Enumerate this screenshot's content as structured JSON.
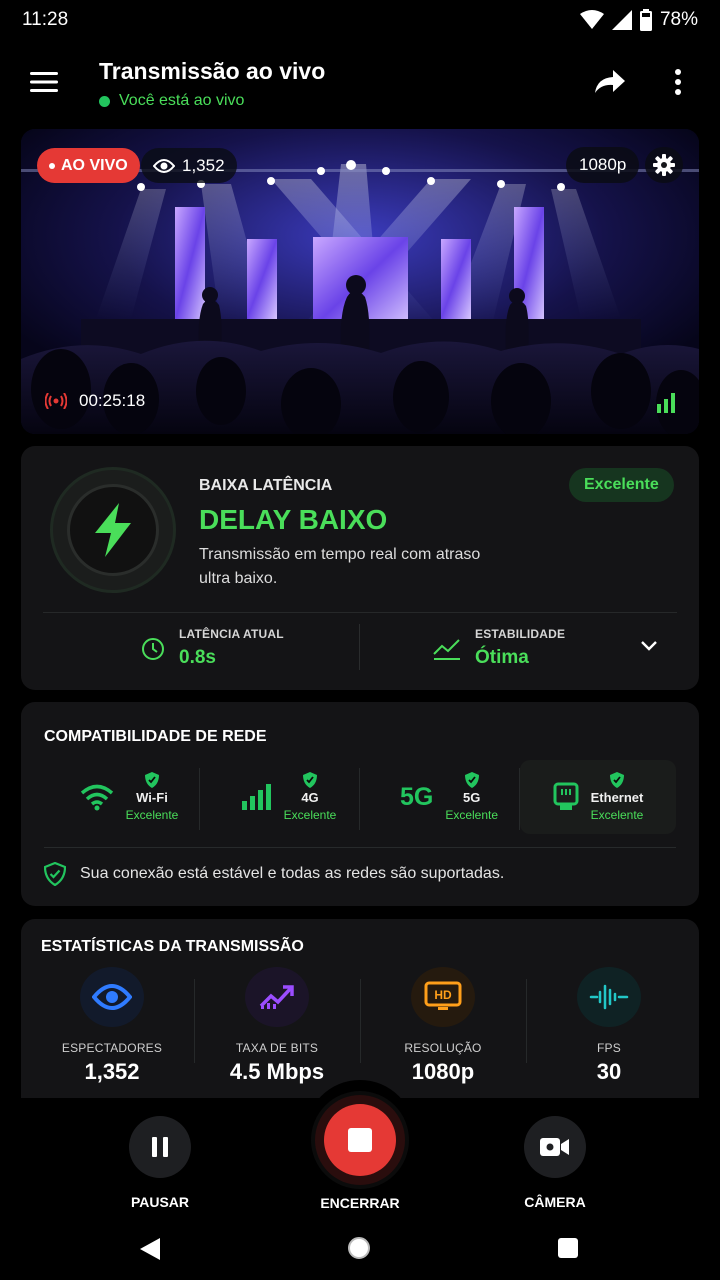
{
  "status_bar": {
    "time": "11:28",
    "battery": "78%"
  },
  "header": {
    "title": "Transmissão ao vivo",
    "subtitle": "Você está ao vivo"
  },
  "video": {
    "live_label": "AO VIVO",
    "viewers": "1,352",
    "resolution": "1080p",
    "elapsed": "00:25:18"
  },
  "latency": {
    "overline": "BAIXA LATÊNCIA",
    "title": "DELAY BAIXO",
    "description": "Transmissão em tempo real com atraso ultra baixo.",
    "badge": "Excelente",
    "current_label": "LATÊNCIA ATUAL",
    "current_value": "0.8s",
    "stability_label": "ESTABILIDADE",
    "stability_value": "Ótima"
  },
  "network": {
    "title": "COMPATIBILIDADE DE REDE",
    "items": [
      {
        "name": "Wi-Fi",
        "status": "Excelente",
        "icon": "wifi-icon"
      },
      {
        "name": "4G",
        "status": "Excelente",
        "icon": "cellular-signal-icon"
      },
      {
        "name": "5G",
        "status": "Excelente",
        "icon": "5g-icon",
        "glyph": "5G"
      },
      {
        "name": "Ethernet",
        "status": "Excelente",
        "icon": "ethernet-icon"
      }
    ],
    "message": "Sua conexão está estável e todas as redes são suportadas."
  },
  "stats": {
    "title": "ESTATÍSTICAS DA TRANSMISSÃO",
    "items": [
      {
        "label": "ESPECTADORES",
        "value": "1,352",
        "icon": "eye-icon",
        "color": "#2f7bff"
      },
      {
        "label": "TAXA DE BITS",
        "value": "4.5 Mbps",
        "icon": "trend-up-icon",
        "color": "#9b4dff"
      },
      {
        "label": "RESOLUÇÃO",
        "value": "1080p",
        "icon": "hd-icon",
        "color": "#ff9f1a"
      },
      {
        "label": "FPS",
        "value": "30",
        "icon": "waveform-icon",
        "color": "#22c7c7"
      }
    ]
  },
  "controls": {
    "pause": "PAUSAR",
    "end": "ENCERRAR",
    "camera": "CÂMERA"
  },
  "colors": {
    "accent_green": "#4ade5a",
    "live_red": "#e53935",
    "card_bg": "#141416"
  }
}
